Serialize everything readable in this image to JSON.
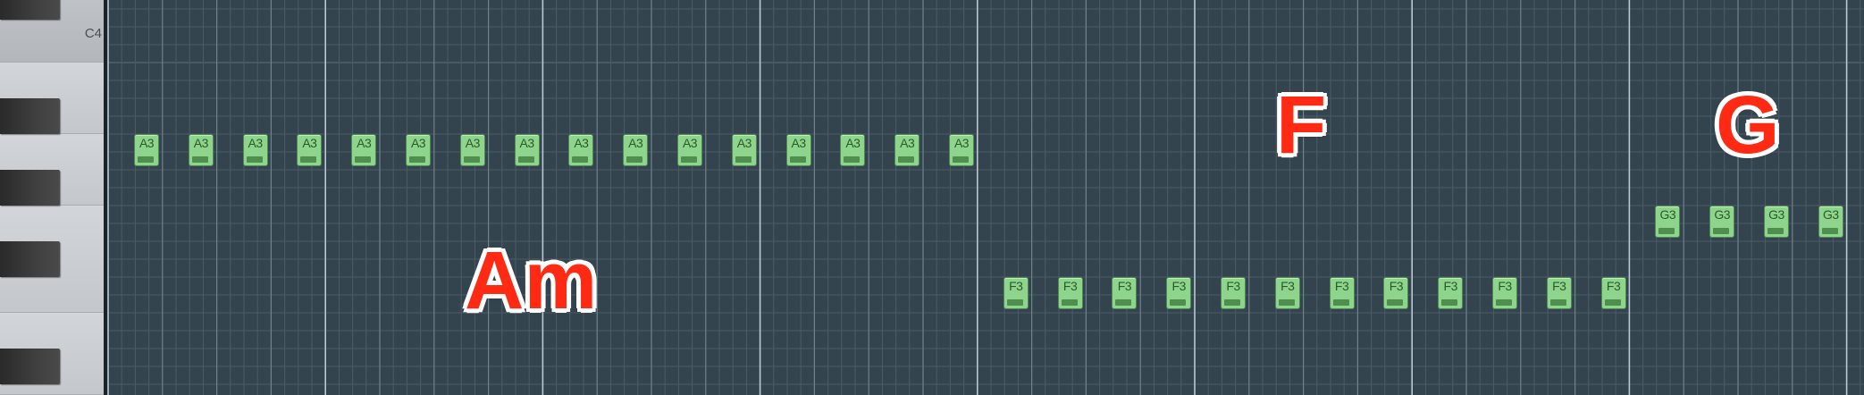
{
  "keyboard": {
    "label_c4": "C4"
  },
  "colors": {
    "grid_background": "#34444f",
    "note_fill": "#8fd48c",
    "chord_text": "#ff2a14"
  },
  "note_rows": {
    "A3": {
      "label": "A3",
      "steps": [
        0,
        1,
        2,
        3,
        4,
        5,
        6,
        7,
        8,
        9,
        10,
        11,
        12,
        13,
        14,
        15
      ]
    },
    "F3": {
      "label": "F3",
      "steps": [
        16,
        17,
        18,
        19,
        20,
        21,
        22,
        23,
        24,
        25,
        26,
        27
      ]
    },
    "G3": {
      "label": "G3",
      "steps": [
        28,
        29,
        30,
        31
      ]
    }
  },
  "chords": {
    "am": "Am",
    "f": "F",
    "g": "G"
  }
}
